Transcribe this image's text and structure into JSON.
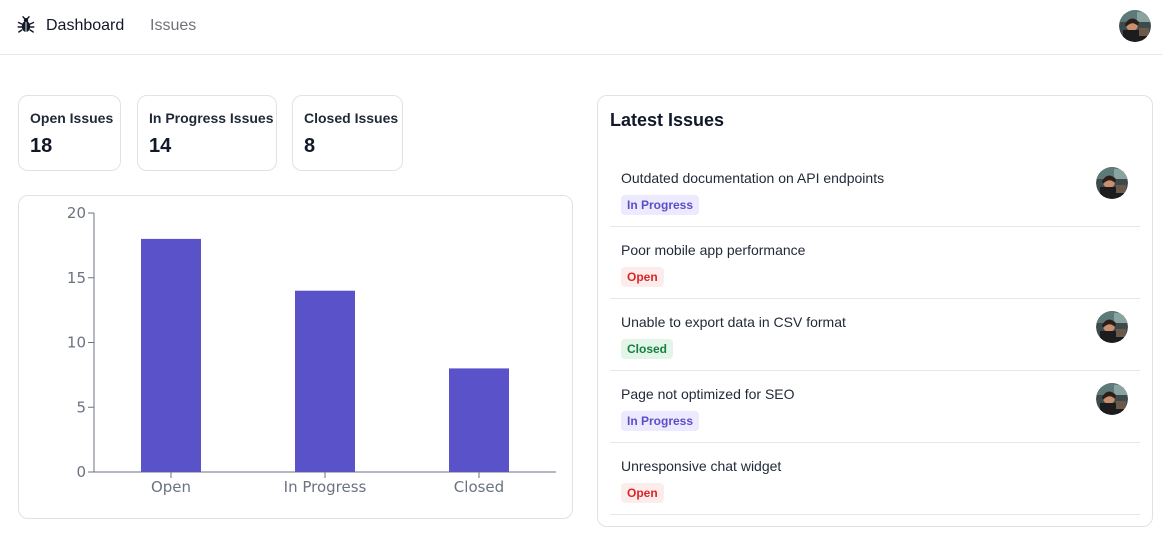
{
  "nav": {
    "logo_icon": "bug-icon",
    "dashboard_label": "Dashboard",
    "issues_label": "Issues",
    "user_avatar_icon": "user-avatar"
  },
  "stats": [
    {
      "label": "Open Issues",
      "value": "18"
    },
    {
      "label": "In Progress Issues",
      "value": "14"
    },
    {
      "label": "Closed Issues",
      "value": "8"
    }
  ],
  "chart_data": {
    "type": "bar",
    "categories": [
      "Open",
      "In Progress",
      "Closed"
    ],
    "values": [
      18,
      14,
      8
    ],
    "ylim": [
      0,
      20
    ],
    "yticks": [
      0,
      5,
      10,
      15,
      20
    ],
    "bar_color": "#5a52c8",
    "grid": false
  },
  "latest_issues": {
    "title": "Latest Issues",
    "items": [
      {
        "title": "Outdated documentation on API endpoints",
        "status": "In Progress",
        "assigned": true
      },
      {
        "title": "Poor mobile app performance",
        "status": "Open",
        "assigned": false
      },
      {
        "title": "Unable to export data in CSV format",
        "status": "Closed",
        "assigned": true
      },
      {
        "title": "Page not optimized for SEO",
        "status": "In Progress",
        "assigned": true
      },
      {
        "title": "Unresponsive chat widget",
        "status": "Open",
        "assigned": false
      }
    ]
  },
  "colors": {
    "accent": "#5a52c8",
    "in_progress_bg": "#ede9fe",
    "in_progress_text": "#5b4fc7",
    "open_bg": "#fdecec",
    "open_text": "#dc2626",
    "closed_bg": "#e3f5e9",
    "closed_text": "#15803d"
  }
}
